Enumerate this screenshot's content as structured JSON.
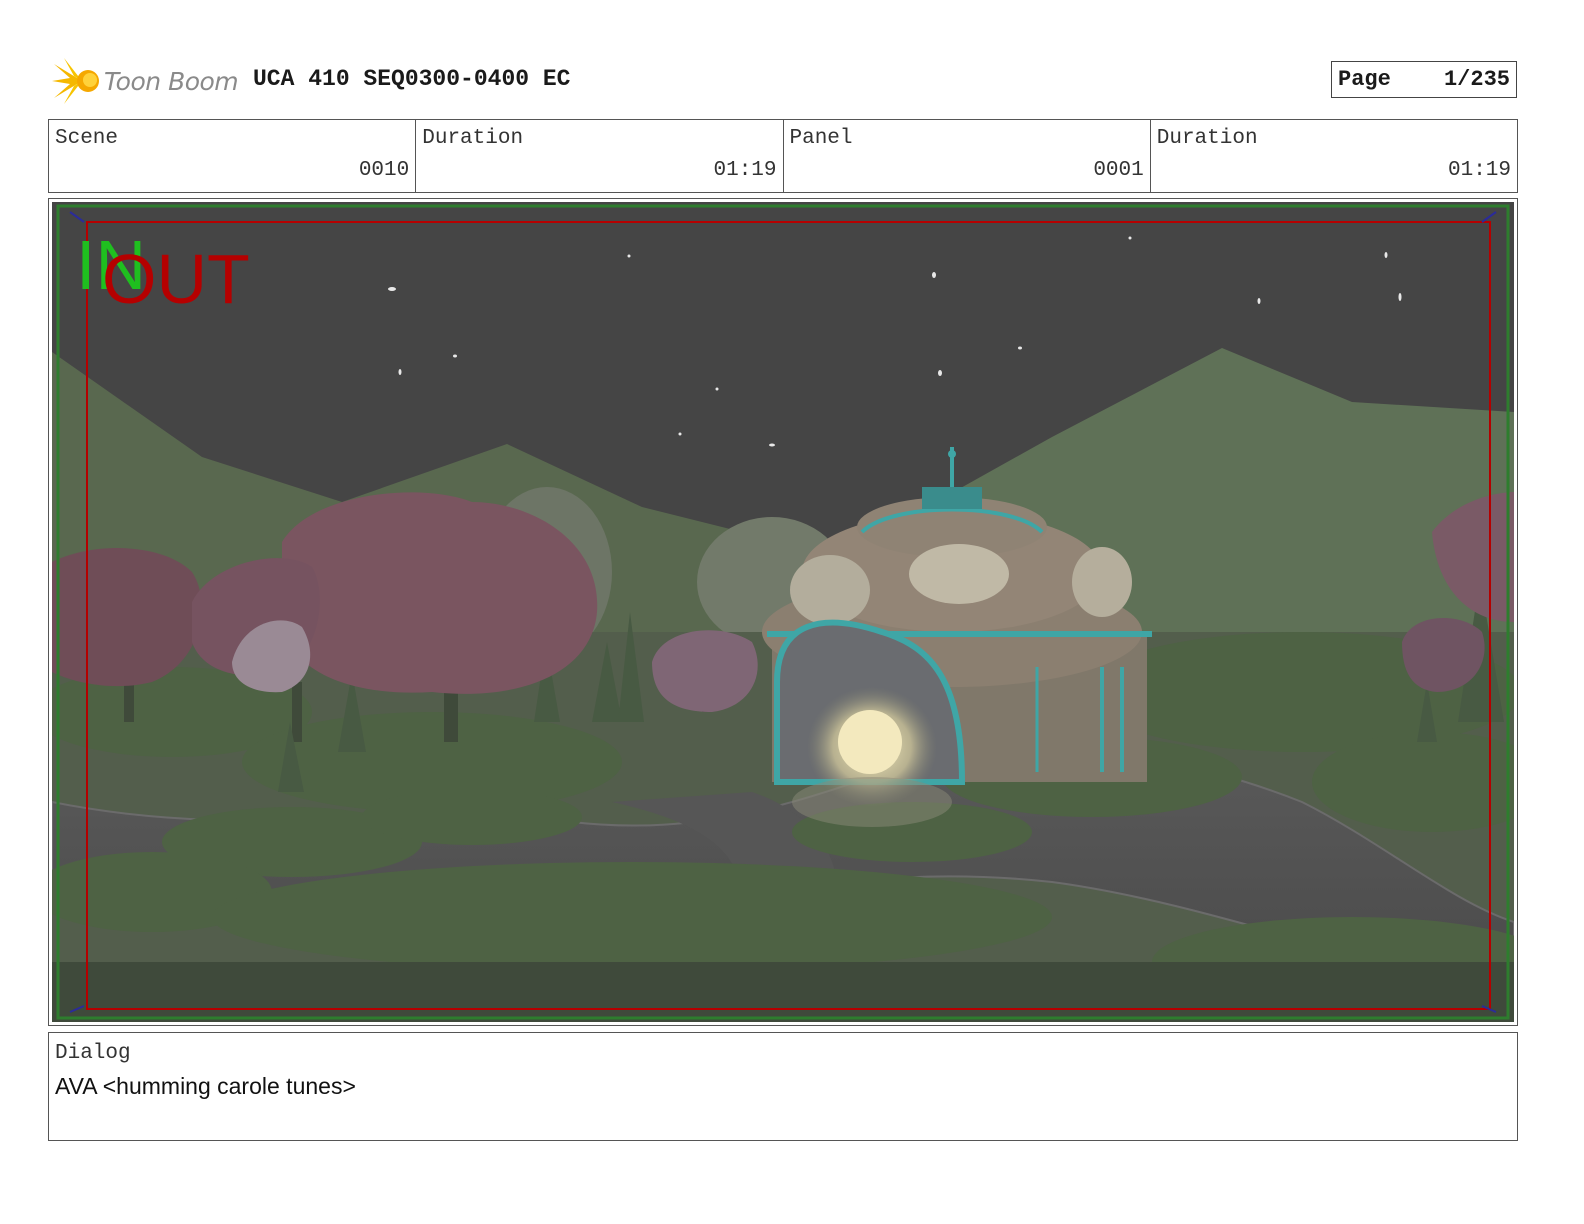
{
  "header": {
    "logo_text": "Toon Boom",
    "project_title": "UCA 410 SEQ0300-0400 EC",
    "page_label": "Page",
    "page_number": "1/235"
  },
  "info": {
    "scene_label": "Scene",
    "scene_value": "0010",
    "scene_duration_label": "Duration",
    "scene_duration_value": "01:19",
    "panel_label": "Panel",
    "panel_value": "0001",
    "panel_duration_label": "Duration",
    "panel_duration_value": "01:19"
  },
  "panel": {
    "in_marker": "IN",
    "out_marker": "OUT"
  },
  "dialog": {
    "label": "Dialog",
    "text": "AVA <humming carole tunes>"
  },
  "colors": {
    "sky": "#454545",
    "hills": "#5d6e55",
    "foliage": "#4e6244",
    "trees_pink": "#7a5560",
    "building_trim": "#3fa6a6",
    "door_glow": "#f2e6b0",
    "safe_frame_red": "#b50000",
    "safe_frame_green": "#2e7d2e",
    "in_green": "#1fbf1f"
  }
}
